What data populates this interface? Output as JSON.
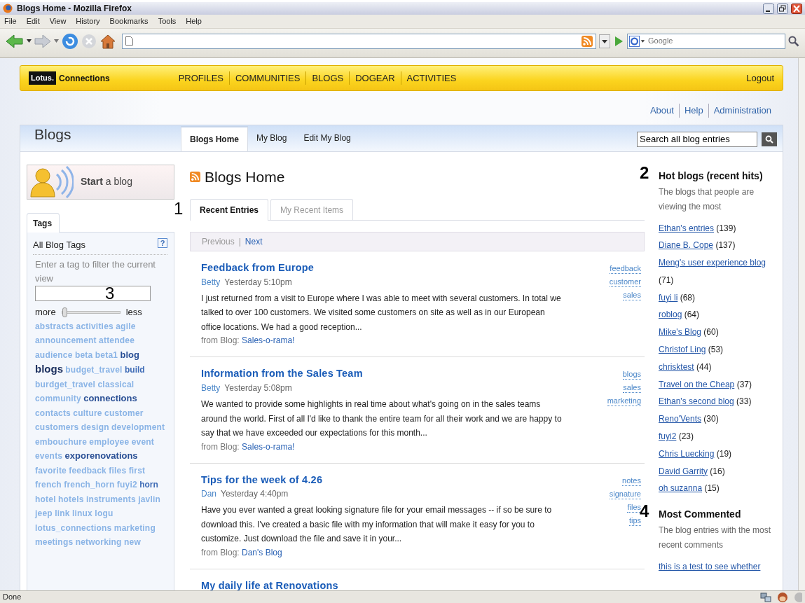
{
  "window": {
    "title": "Blogs Home - Mozilla Firefox"
  },
  "menu": [
    "File",
    "Edit",
    "View",
    "History",
    "Bookmarks",
    "Tools",
    "Help"
  ],
  "toolbar": {
    "search_placeholder": "Google"
  },
  "banner": {
    "logo_mark": "Lotus.",
    "logo_text": "Connections",
    "nav": [
      "PROFILES",
      "COMMUNITIES",
      "BLOGS",
      "DOGEAR",
      "ACTIVITIES"
    ],
    "logout": "Logout"
  },
  "util_links": [
    "About",
    "Help",
    "Administration"
  ],
  "app": {
    "title": "Blogs",
    "tabs": [
      {
        "label": "Blogs Home",
        "selected": true
      },
      {
        "label": "My Blog",
        "selected": false
      },
      {
        "label": "Edit My Blog",
        "selected": false
      }
    ],
    "search": {
      "value": "Search all blog entries"
    }
  },
  "start_blog": "**Start** a blog",
  "tags": {
    "tab": "Tags",
    "heading": "All Blog Tags",
    "help": "?",
    "hint": "Enter a tag to filter the current view",
    "callout": "3",
    "slider": {
      "min_label": "more",
      "max_label": "less",
      "level": 0
    },
    "cloud": [
      {
        "label": "abstracts",
        "kind": "light"
      },
      {
        "label": "activities",
        "kind": "light"
      },
      {
        "label": "agile",
        "kind": "light"
      },
      {
        "label": "announcement",
        "kind": "light"
      },
      {
        "label": "attendee",
        "kind": "light"
      },
      {
        "label": "audience",
        "kind": "light"
      },
      {
        "label": "beta",
        "kind": "light"
      },
      {
        "label": "beta1",
        "kind": "light"
      },
      {
        "label": "blog",
        "kind": "heavy"
      },
      {
        "label": "blogs",
        "kind": "top"
      },
      {
        "label": "budget_travel",
        "kind": "light"
      },
      {
        "label": "build",
        "kind": "medium"
      },
      {
        "label": "burdget_travel",
        "kind": "light"
      },
      {
        "label": "classical",
        "kind": "light"
      },
      {
        "label": "community",
        "kind": "light"
      },
      {
        "label": "connections",
        "kind": "heavy"
      },
      {
        "label": "contacts",
        "kind": "light"
      },
      {
        "label": "culture",
        "kind": "light"
      },
      {
        "label": "customer",
        "kind": "light"
      },
      {
        "label": "customers",
        "kind": "light"
      },
      {
        "label": "design",
        "kind": "light"
      },
      {
        "label": "development",
        "kind": "light"
      },
      {
        "label": "embouchure",
        "kind": "light"
      },
      {
        "label": "employee",
        "kind": "light"
      },
      {
        "label": "event",
        "kind": "light"
      },
      {
        "label": "events",
        "kind": "light"
      },
      {
        "label": "exporenovations",
        "kind": "heavy"
      },
      {
        "label": "favorite",
        "kind": "light"
      },
      {
        "label": "feedback",
        "kind": "light"
      },
      {
        "label": "files",
        "kind": "light"
      },
      {
        "label": "first",
        "kind": "light"
      },
      {
        "label": "french",
        "kind": "light"
      },
      {
        "label": "french_horn",
        "kind": "light"
      },
      {
        "label": "fuyi2",
        "kind": "light"
      },
      {
        "label": "horn",
        "kind": "medium"
      },
      {
        "label": "hotel",
        "kind": "light"
      },
      {
        "label": "hotels",
        "kind": "light"
      },
      {
        "label": "instruments",
        "kind": "light"
      },
      {
        "label": "javlin",
        "kind": "light"
      },
      {
        "label": "jeep",
        "kind": "light"
      },
      {
        "label": "link",
        "kind": "light"
      },
      {
        "label": "linux",
        "kind": "light"
      },
      {
        "label": "logu",
        "kind": "light"
      },
      {
        "label": "lotus_connections",
        "kind": "light"
      },
      {
        "label": "marketing",
        "kind": "light"
      },
      {
        "label": "meetings",
        "kind": "light"
      },
      {
        "label": "networking",
        "kind": "light"
      },
      {
        "label": "new",
        "kind": "light"
      }
    ]
  },
  "page_title": "Blogs Home",
  "entry_tabs": {
    "callout": "1",
    "tabs": [
      {
        "label": "Recent Entries",
        "selected": true
      },
      {
        "label": "My Recent Items",
        "selected": false
      }
    ]
  },
  "pager": [
    {
      "label": "Previous",
      "disabled": true
    },
    {
      "label": "|",
      "kind": "separator"
    },
    {
      "label": "Next",
      "disabled": false
    }
  ],
  "entries": [
    {
      "title": "Feedback from Europe",
      "author": "Betty",
      "time": "Yesterday 5:10pm",
      "body": "I just returned from a visit to Europe where I was able to meet with several customers.   In total we talked to over 100 customers.   We visited some customers on site as well as in our European office locations.   We had a good reception...",
      "from_label": "from Blog:",
      "blog": "Sales-o-rama!",
      "tags": [
        "feedback",
        "customer",
        "sales"
      ]
    },
    {
      "title": "Information from the Sales Team",
      "author": "Betty",
      "time": "Yesterday 5:08pm",
      "body": "We wanted to provide some highlights in real time about what's going on in the sales teams around the world.   First of all I'd like to thank the entire team for all their work and we are happy to say that we have exceeded our expectations for this month...",
      "from_label": "from Blog:",
      "blog": "Sales-o-rama!",
      "tags": [
        "blogs",
        "sales",
        "marketing"
      ]
    },
    {
      "title": "Tips for the week of 4.26",
      "author": "Dan",
      "time": "Yesterday 4:40pm",
      "body": "Have you ever wanted a great looking signature file for your email messages -- if so be sure to download this.   I've created a basic file with my information that will make it easy for you to customize.   Just download the file and save it in your...",
      "from_label": "from Blog:",
      "blog": "Dan's Blog",
      "tags": [
        "notes",
        "signature",
        "files",
        "tips"
      ]
    },
    {
      "title": "My daily life at Renovations"
    }
  ],
  "hot_blogs": {
    "callout": "2",
    "title": "Hot blogs (recent hits)",
    "description": "The blogs that people are viewing the most",
    "items": [
      {
        "name": "Ethan's entries",
        "count": "(139)"
      },
      {
        "name": "Diane B. Cope",
        "count": "(137)"
      },
      {
        "name": "Meng's user experience blog",
        "count": "(71)"
      },
      {
        "name": "fuyi li",
        "count": "(68)"
      },
      {
        "name": "roblog",
        "count": "(64)"
      },
      {
        "name": "Mike's Blog",
        "count": "(60)"
      },
      {
        "name": "Christof Ling",
        "count": "(53)"
      },
      {
        "name": "chrisktest",
        "count": "(44)"
      },
      {
        "name": "Travel on the Cheap",
        "count": "(37)"
      },
      {
        "name": "Ethan's second blog",
        "count": "(33)"
      },
      {
        "name": "Reno'Vents",
        "count": "(30)"
      },
      {
        "name": "fuyi2",
        "count": "(23)"
      },
      {
        "name": "Chris Luecking",
        "count": "(19)"
      },
      {
        "name": "David Garrity",
        "count": "(16)"
      },
      {
        "name": "oh suzanna",
        "count": "(15)"
      }
    ]
  },
  "most_commented": {
    "callout": "4",
    "title": "Most Commented",
    "description": "The blog entries with the most recent comments",
    "items": [
      "this is a test to see whether"
    ]
  },
  "status_bar": {
    "text": "Done"
  }
}
